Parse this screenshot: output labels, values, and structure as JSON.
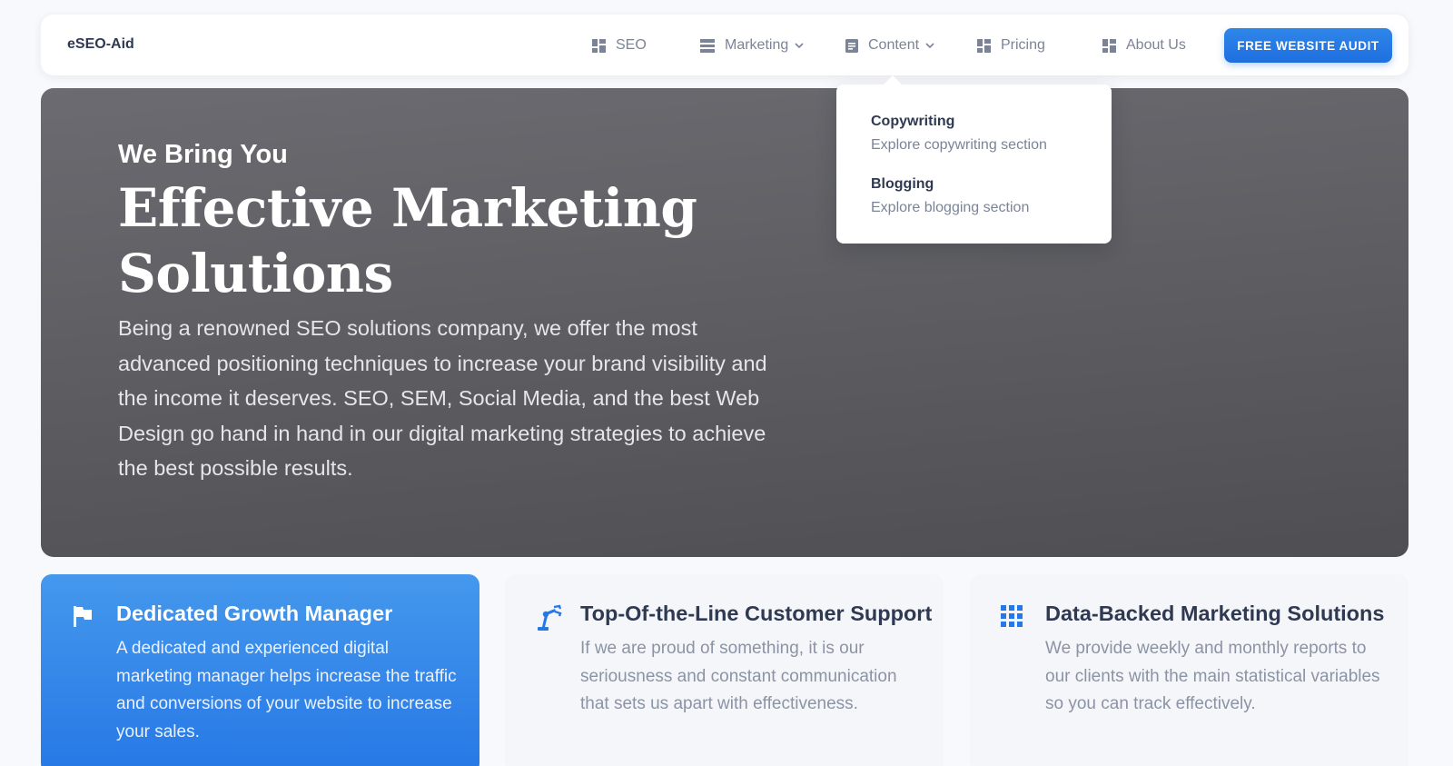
{
  "navbar": {
    "brand": "eSEO-Aid",
    "items": [
      {
        "label": "SEO",
        "icon": "dashboard-icon"
      },
      {
        "label": "Marketing",
        "icon": "list-icon",
        "has_dropdown": true
      },
      {
        "label": "Content",
        "icon": "document-icon",
        "has_dropdown": true,
        "active": true
      },
      {
        "label": "Pricing",
        "icon": "dashboard-icon"
      },
      {
        "label": "About Us",
        "icon": "dashboard-icon"
      }
    ],
    "cta_label": "FREE WEBSITE AUDIT"
  },
  "dropdown": {
    "items": [
      {
        "title": "Copywriting",
        "description": "Explore copywriting section"
      },
      {
        "title": "Blogging",
        "description": "Explore blogging section"
      }
    ]
  },
  "hero": {
    "subtitle": "We Bring You",
    "title": "Effective Marketing Solutions",
    "description": "Being a renowned SEO solutions company, we offer the most advanced positioning techniques to increase your brand visibility and the income it deserves. SEO, SEM, Social Media, and the best Web Design go hand in hand in our digital marketing strategies to achieve the best possible results."
  },
  "features": [
    {
      "title": "Dedicated Growth Manager",
      "description": "A dedicated and experienced digital marketing manager helps increase the traffic and conversions of your website to increase your sales.",
      "icon": "flag-icon"
    },
    {
      "title": "Top-Of-the-Line Customer Support",
      "description": "If we are proud of something, it is our seriousness and constant communication that sets us apart with effectiveness.",
      "icon": "robot-arm-icon"
    },
    {
      "title": "Data-Backed Marketing Solutions",
      "description": "We provide weekly and monthly reports to our clients with the main statistical variables so you can track effectively.",
      "icon": "grid-icon"
    }
  ],
  "colors": {
    "accent": "#2678e6",
    "text_dark": "#2f3a52",
    "text_muted": "#7b8497",
    "hero_bg": "#5e5e63"
  }
}
